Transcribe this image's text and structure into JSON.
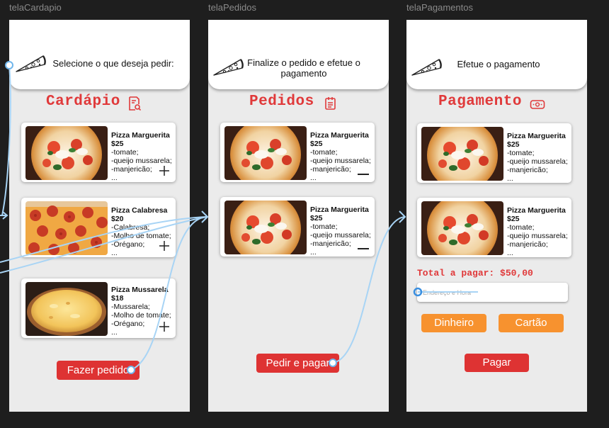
{
  "frames": {
    "cardapio": {
      "label": "telaCardapio",
      "header_text": "Selecione o que deseja pedir:",
      "title": "Cardápio",
      "items": [
        {
          "name": "Pizza Marguerita",
          "price": "$25",
          "lines": [
            "-tomate;",
            "-queijo mussarela;",
            "-manjericão;",
            "..."
          ]
        },
        {
          "name": "Pizza Calabresa",
          "price": "$20",
          "lines": [
            "-Calabresa;",
            "-Molho de tomate;",
            "-Orégano;",
            "..."
          ]
        },
        {
          "name": "Pizza Mussarela",
          "price": "$18",
          "lines": [
            "-Mussarela;",
            "-Molho de tomate;",
            "-Orégano;",
            "..."
          ]
        }
      ],
      "button": "Fazer pedido"
    },
    "pedidos": {
      "label": "telaPedidos",
      "header_text": "Finalize o pedido e efetue o pagamento",
      "title": "Pedidos",
      "items": [
        {
          "name": "Pizza Marguerita",
          "price": "$25",
          "lines": [
            "-tomate;",
            "-queijo mussarela;",
            "-manjericão;",
            "..."
          ]
        },
        {
          "name": "Pizza Marguerita",
          "price": "$25",
          "lines": [
            "-tomate;",
            "-queijo mussarela;",
            "-manjericão;",
            "..."
          ]
        }
      ],
      "button": "Pedir e pagar"
    },
    "pagamentos": {
      "label": "telaPagamentos",
      "header_text": "Efetue o pagamento",
      "title": "Pagamento",
      "items": [
        {
          "name": "Pizza Marguerita",
          "price": "$25",
          "lines": [
            "-tomate;",
            "-queijo mussarela;",
            "-manjericão;",
            "..."
          ]
        },
        {
          "name": "Pizza Marguerita",
          "price": "$25",
          "lines": [
            "-tomate;",
            "-queijo mussarela;",
            "-manjericão;",
            "..."
          ]
        }
      ],
      "total": "Total a pagar: $50,00",
      "address_placeholder": "Endereço e Hora",
      "cash_button": "Dinheiro",
      "card_button": "Cartão",
      "pay_button": "Pagar"
    }
  },
  "colors": {
    "accent_red": "#e0393a",
    "button_red": "#de3333",
    "button_orange": "#f7922f",
    "prototype_wire": "#a8d4f5",
    "canvas": "#1e1e1e"
  }
}
